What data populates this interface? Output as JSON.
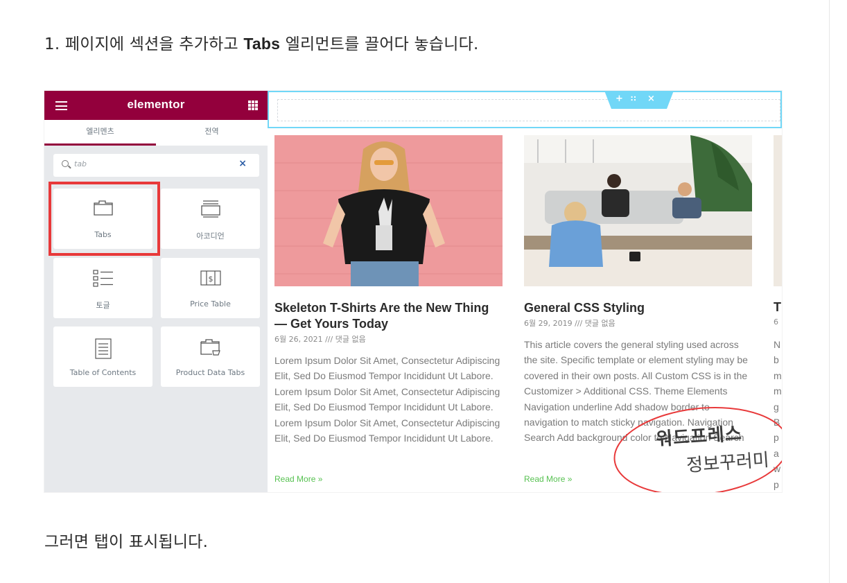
{
  "step1": {
    "pre": "1. 페이지에 섹션을 추가하고 ",
    "bold": "Tabs",
    "post": " 엘리먼트를 끌어다 놓습니다."
  },
  "after": "그러면 탭이 표시됩니다.",
  "elementor": {
    "brand": "elementor",
    "tabs": [
      "엘리멘츠",
      "전역"
    ],
    "search_value": "tab",
    "widgets": [
      {
        "label": "Tabs",
        "icon": "tabs-icon"
      },
      {
        "label": "아코디언",
        "icon": "accordion-icon"
      },
      {
        "label": "토글",
        "icon": "toggle-icon"
      },
      {
        "label": "Price Table",
        "icon": "price-table-icon"
      },
      {
        "label": "Table of Contents",
        "icon": "table-of-contents-icon"
      },
      {
        "label": "Product Data Tabs",
        "icon": "product-data-tabs-icon"
      }
    ],
    "highlight_color": "#e8393a",
    "brand_color": "#93003c"
  },
  "posts": [
    {
      "title": "Skeleton T-Shirts Are the New Thing — Get Yours Today",
      "meta": "6월 26, 2021 /// 댓글 없음",
      "body": "Lorem Ipsum Dolor Sit Amet, Consectetur Adipiscing Elit, Sed Do Eiusmod Tempor Incididunt Ut Labore. Lorem Ipsum Dolor Sit Amet, Consectetur Adipiscing Elit, Sed Do Eiusmod Tempor Incididunt Ut Labore. Lorem Ipsum Dolor Sit Amet, Consectetur Adipiscing Elit, Sed Do Eiusmod Tempor Incididunt Ut Labore.",
      "more": "Read More »"
    },
    {
      "title": "General CSS Styling",
      "meta": "6월 29, 2019 /// 댓글 없음",
      "body": "This article covers the general styling used across the site. Specific template or element styling may be covered in their own posts. All Custom CSS is in the Customizer > Additional CSS. Theme Elements Navigation underline Add shadow border to navigation to match sticky navigation. Navigation Search Add background color to Navigation Search",
      "more": "Read More »"
    }
  ],
  "post3_fragment": {
    "title": "T",
    "meta": "6",
    "body": "N b m m g B p a w p"
  },
  "stamp": {
    "line1": "워드프레스",
    "line2": "정보꾸러미"
  },
  "accent_green": "#56c150",
  "accent_cyan": "#71d7f7"
}
